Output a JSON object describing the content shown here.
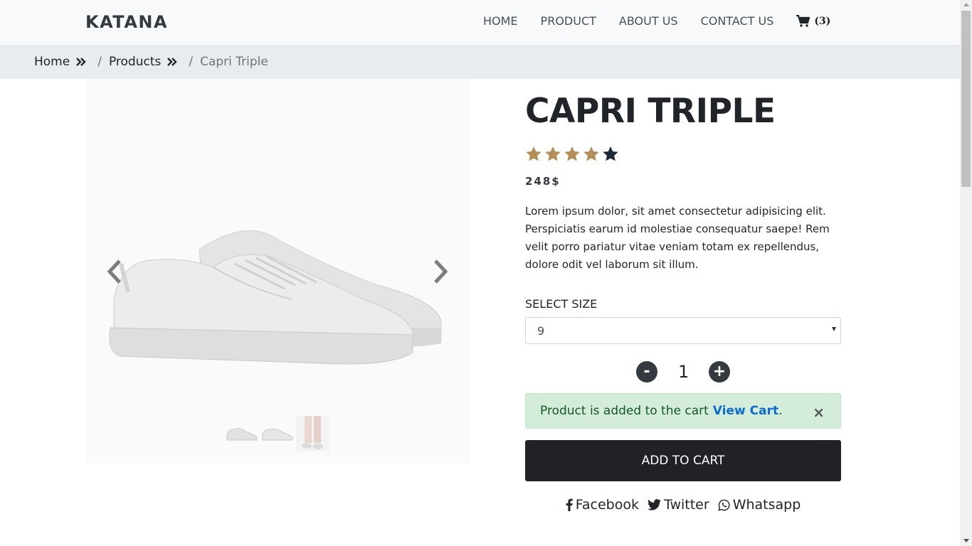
{
  "brand": "KATANA",
  "nav": {
    "home": "HOME",
    "product": "PRODUCT",
    "about": "ABOUT US",
    "contact": "CONTACT US",
    "cart_count": "(3)"
  },
  "breadcrumb": {
    "home": "Home",
    "products": "Products",
    "current": "Capri Triple",
    "separator": "/"
  },
  "product": {
    "title": "CAPRI TRIPLE",
    "rating": 4,
    "rating_max": 5,
    "price": "248$",
    "description": "Lorem ipsum dolor, sit amet consectetur adipisicing elit. Perspiciatis earum id molestiae consequatur saepe! Rem velit porro pariatur vitae veniam totam ex repellendus, dolore odit vel laborum sit illum.",
    "size_label": "SELECT SIZE",
    "size_selected": "9",
    "quantity": "1",
    "qty_minus": "-",
    "qty_plus": "+"
  },
  "alert": {
    "message": "Product is added to the cart",
    "link": "View Cart",
    "period": ".",
    "close": "×"
  },
  "add_to_cart": "ADD TO CART",
  "share": {
    "facebook": "Facebook",
    "twitter": "Twitter",
    "whatsapp": "Whatsapp"
  },
  "colors": {
    "star_filled": "#b48e57",
    "star_empty": "#1e2a38",
    "alert_bg": "#d4edda",
    "button_dark": "#212227"
  }
}
